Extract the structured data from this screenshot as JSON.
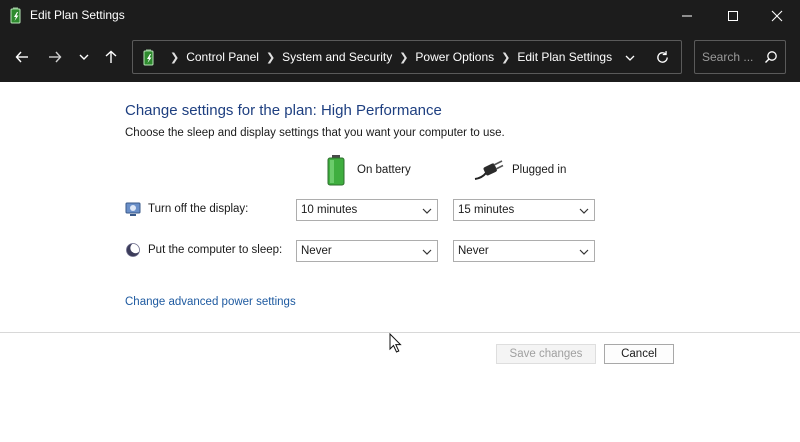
{
  "window": {
    "title": "Edit Plan Settings"
  },
  "address_bar": {
    "crumbs": [
      "Control Panel",
      "System and Security",
      "Power Options",
      "Edit Plan Settings"
    ]
  },
  "search": {
    "placeholder": "Search ..."
  },
  "main": {
    "heading": "Change settings for the plan: High Performance",
    "subtext": "Choose the sleep and display settings that you want your computer to use.",
    "columns": {
      "battery": "On battery",
      "plugged": "Plugged in"
    },
    "rows": [
      {
        "label": "Turn off the display:",
        "battery": "10 minutes",
        "plugged": "15 minutes"
      },
      {
        "label": "Put the computer to sleep:",
        "battery": "Never",
        "plugged": "Never"
      }
    ],
    "advanced_link": "Change advanced power settings"
  },
  "footer": {
    "save_label": "Save changes",
    "cancel_label": "Cancel"
  },
  "colors": {
    "heading": "#1e3f80",
    "link": "#1e5aa0",
    "titlebar": "#1c1c1c"
  }
}
